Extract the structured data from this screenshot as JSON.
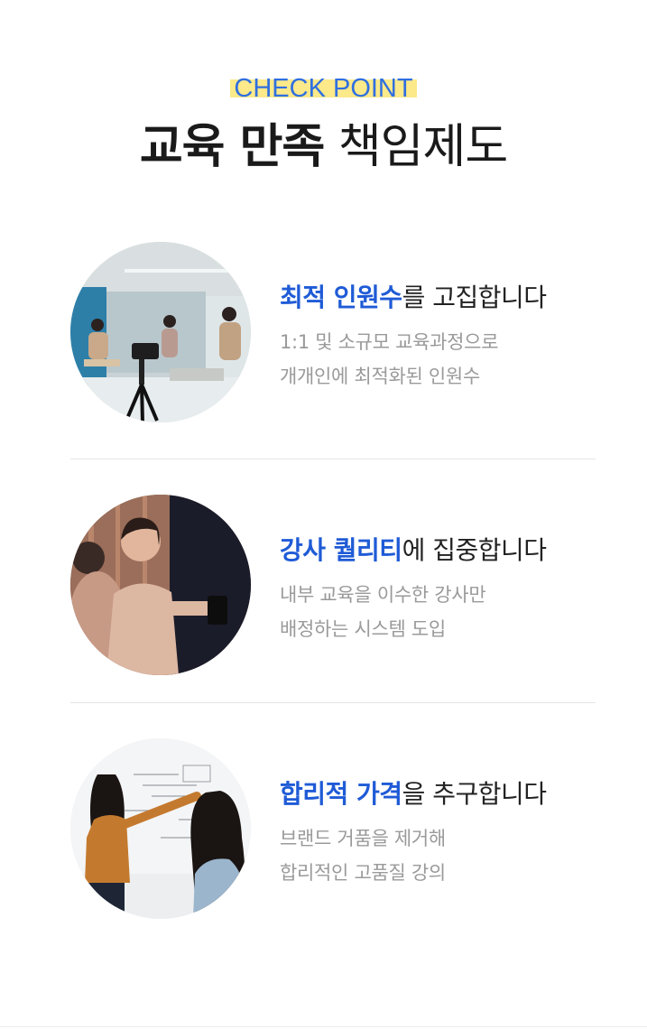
{
  "header": {
    "eyebrow": "CHECK POINT",
    "title_bold": "교육 만족",
    "title_light": "책임제도"
  },
  "items": [
    {
      "head_highlight": "최적 인원수",
      "head_rest": "를 고집합니다",
      "desc_line1": "1:1 및 소규모 교육과정으로",
      "desc_line2": "개개인에 최적화된 인원수"
    },
    {
      "head_highlight": "강사 퀄리티",
      "head_rest": "에 집중합니다",
      "desc_line1": "내부 교육을 이수한 강사만",
      "desc_line2": "배정하는 시스템 도입"
    },
    {
      "head_highlight": "합리적 가격",
      "head_rest": "을 추구합니다",
      "desc_line1": "브랜드 거품을 제거해",
      "desc_line2": "합리적인 고품질 강의"
    }
  ],
  "colors": {
    "accent": "#1f5bd6",
    "eyebrow": "#2f6fe0",
    "highlight": "#fbe98a",
    "body_text": "#222222",
    "muted_text": "#9a9a9a"
  }
}
